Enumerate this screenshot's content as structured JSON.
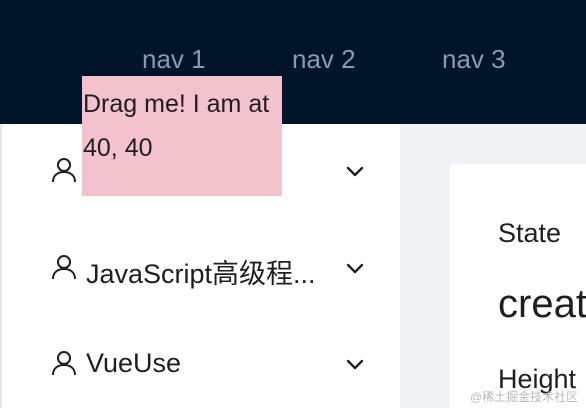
{
  "header": {
    "nav": [
      {
        "label": "nav 1"
      },
      {
        "label": "nav 2"
      },
      {
        "label": "nav 3"
      }
    ]
  },
  "sidebar": {
    "items": [
      {
        "label": "",
        "icon": "user-icon"
      },
      {
        "label": "JavaScript高级程...",
        "icon": "user-icon"
      },
      {
        "label": "VueUse",
        "icon": "user-icon"
      }
    ]
  },
  "draggable": {
    "text": "Drag me! I am at 40, 40"
  },
  "card": {
    "title": "State",
    "state_value": "creat",
    "height_label": "Height"
  },
  "watermark": "@稀土掘金技术社区",
  "colors": {
    "header_bg": "#001529",
    "nav_text": "#8a9bb0",
    "drag_bg": "#f4c2cc",
    "content_bg": "#f0f2f5"
  }
}
